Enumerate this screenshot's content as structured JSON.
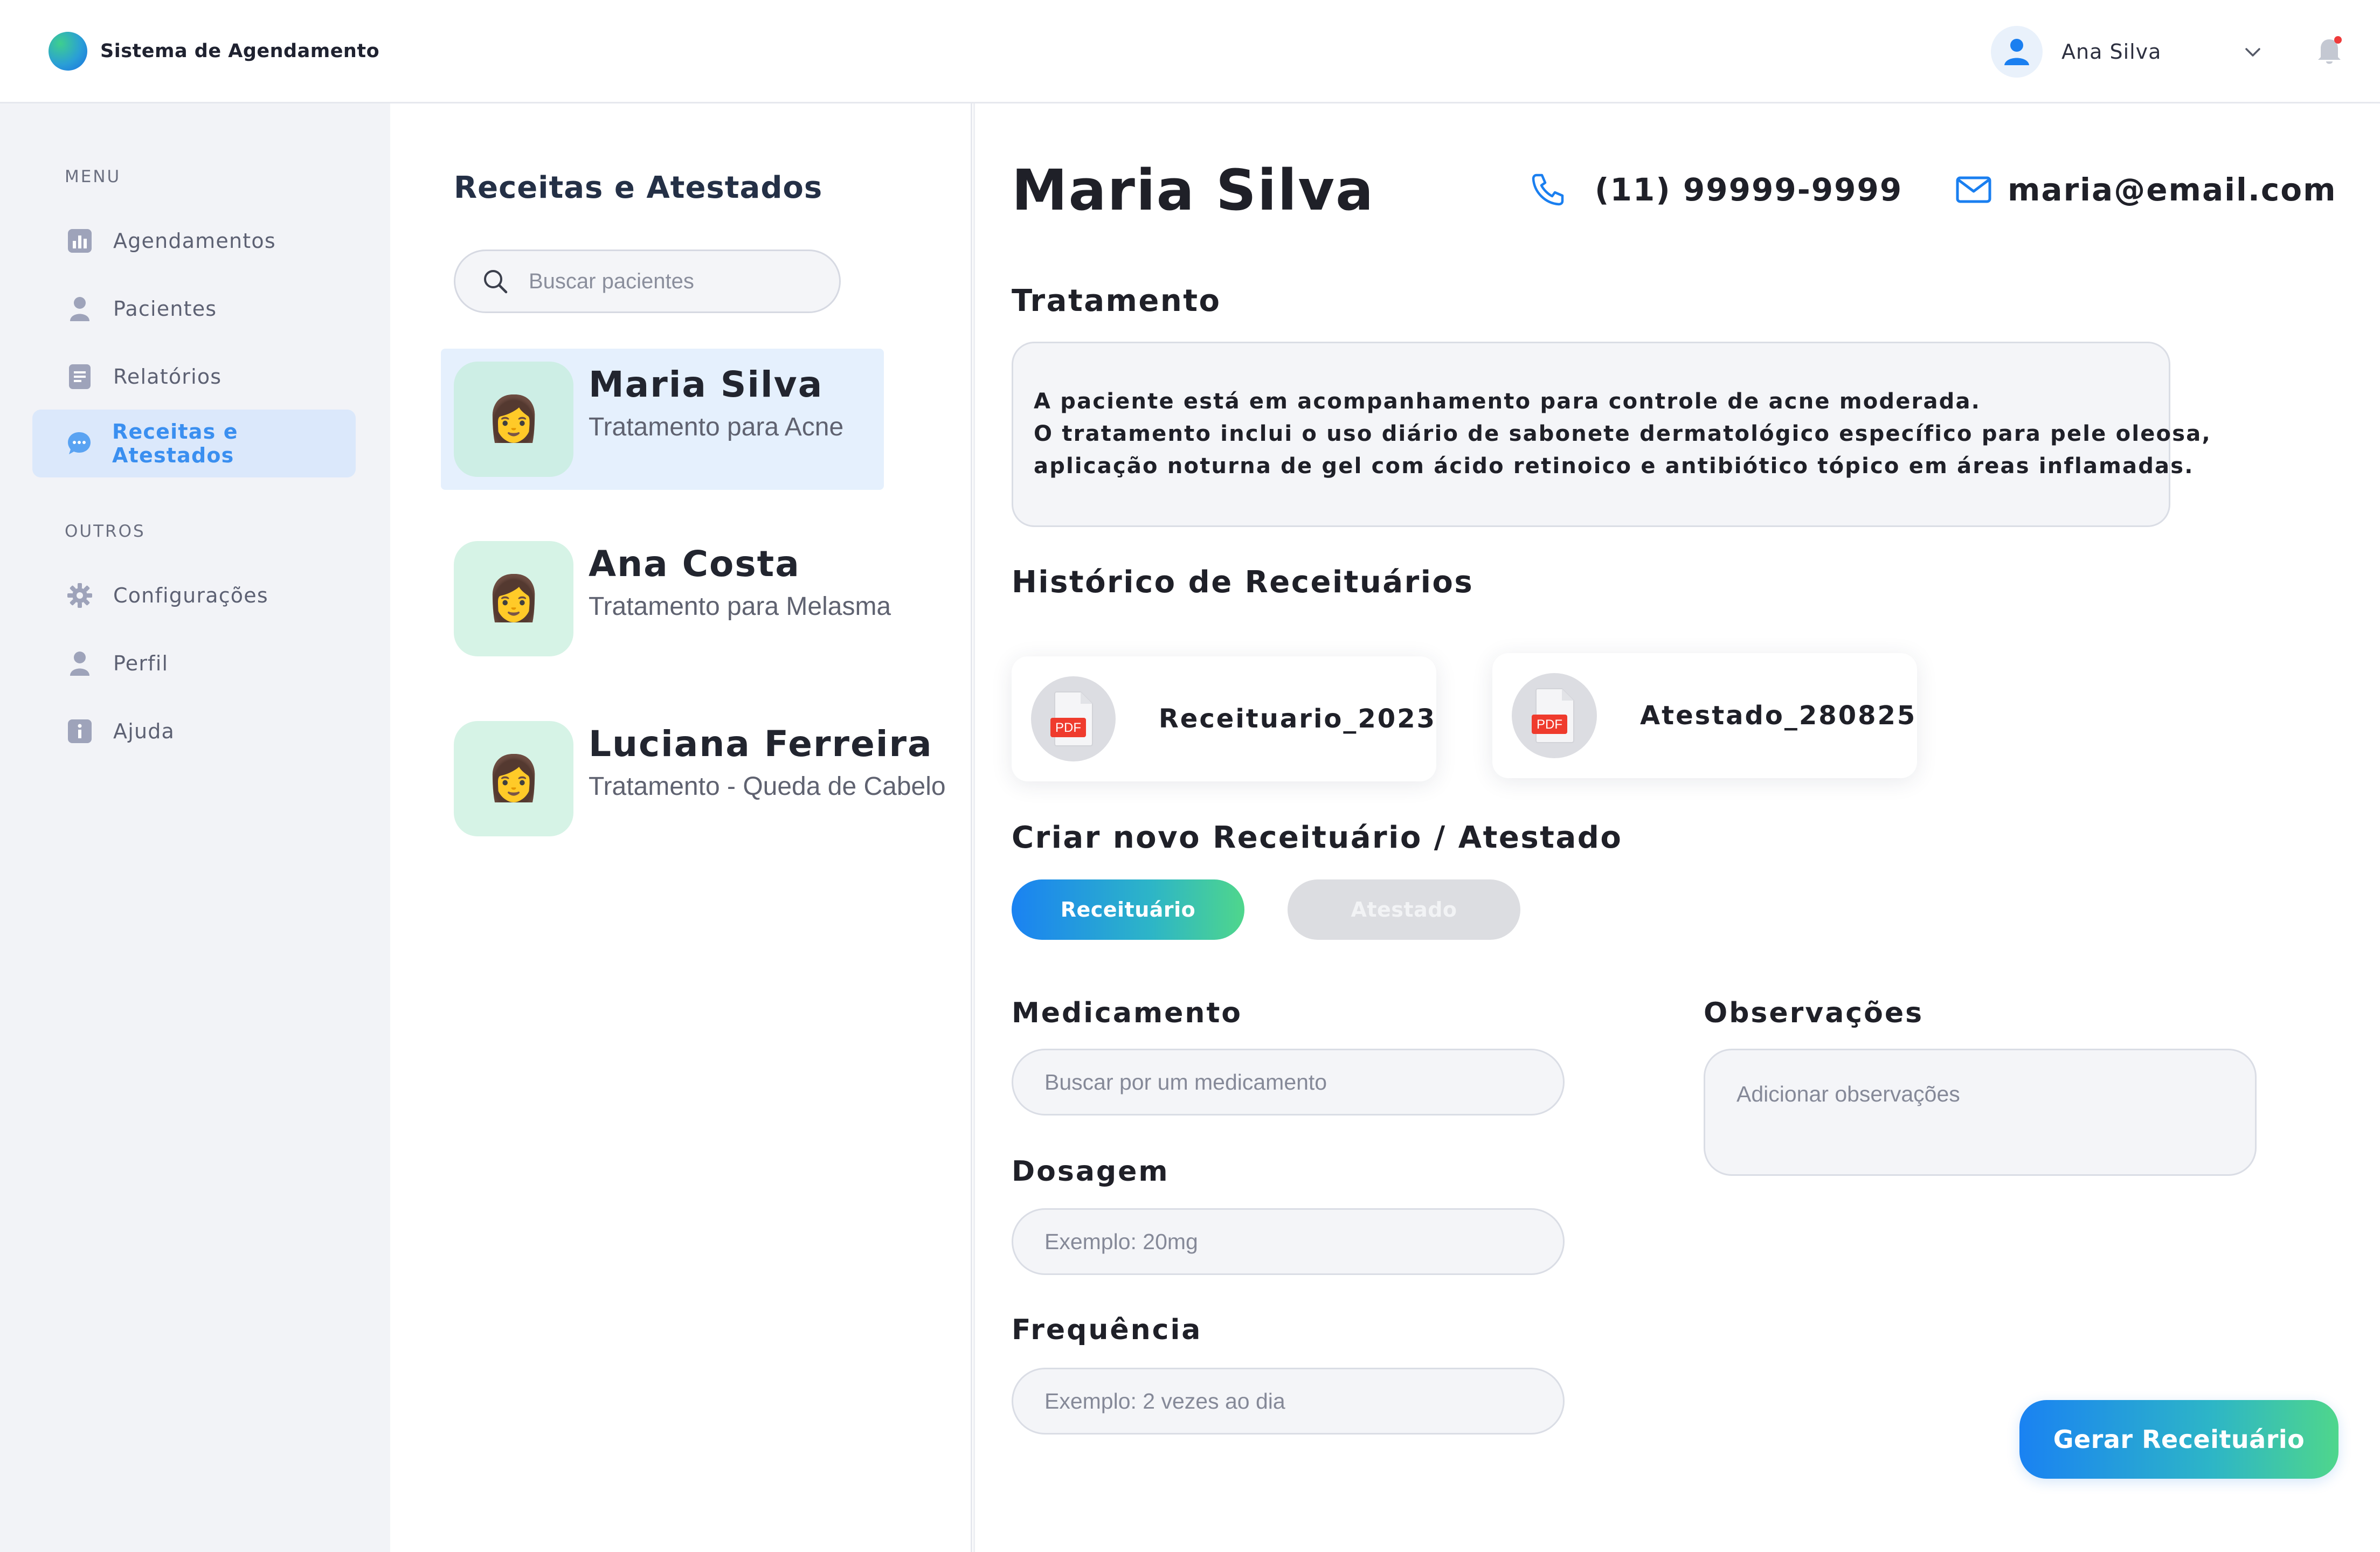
{
  "brand": {
    "name": "Sistema de Agendamento"
  },
  "user": {
    "name": "Ana Silva"
  },
  "sidebar": {
    "menu_label": "MENU",
    "others_label": "OUTROS",
    "menu_items": [
      {
        "label": "Agendamentos",
        "icon": "chart-icon"
      },
      {
        "label": "Pacientes",
        "icon": "user-icon"
      },
      {
        "label": "Relatórios",
        "icon": "document-icon"
      },
      {
        "label": "Receitas e Atestados",
        "icon": "chat-icon",
        "active": true
      }
    ],
    "other_items": [
      {
        "label": "Configurações",
        "icon": "gear-icon"
      },
      {
        "label": "Perfil",
        "icon": "user-icon"
      },
      {
        "label": "Ajuda",
        "icon": "info-icon"
      }
    ]
  },
  "middle": {
    "title": "Receitas e Atestados",
    "search_placeholder": "Buscar pacientes",
    "patients": [
      {
        "name": "Maria Silva",
        "desc": "Tratamento para Acne",
        "avatar": "👩",
        "selected": true
      },
      {
        "name": "Ana Costa",
        "desc": "Tratamento para Melasma",
        "avatar": "👩"
      },
      {
        "name": "Luciana Ferreira",
        "desc": "Tratamento - Queda de Cabelo",
        "avatar": "👩"
      }
    ]
  },
  "main": {
    "patient_name": "Maria Silva",
    "phone": "(11) 99999-9999",
    "email": "maria@email.com",
    "treatment_title": "Tratamento",
    "treatment_lines": [
      "A paciente está em acompanhamento para controle de acne moderada.",
      "O tratamento inclui o uso diário de sabonete dermatológico específico para pele oleosa,",
      "aplicação noturna de gel com ácido retinoico e antibiótico tópico em áreas inflamadas."
    ],
    "history_title": "Histórico de Receituários",
    "documents": [
      {
        "name": "Receituario_2023",
        "badge": "PDF"
      },
      {
        "name": "Atestado_280825",
        "badge": "PDF"
      }
    ],
    "create_title": "Criar novo Receituário / Atestado",
    "tabs": [
      {
        "label": "Receituário",
        "active": true
      },
      {
        "label": "Atestado",
        "active": false
      }
    ],
    "form": {
      "medication_label": "Medicamento",
      "medication_placeholder": "Buscar por um medicamento",
      "dosage_label": "Dosagem",
      "dosage_placeholder": "Exemplo: 20mg",
      "frequency_label": "Frequência",
      "frequency_placeholder": "Exemplo: 2 vezes ao dia",
      "observations_label": "Observações",
      "observations_placeholder": "Adicionar observações"
    },
    "generate_label": "Gerar Receituário"
  },
  "colors": {
    "accent": "#1a82f2",
    "accent_green": "#4fd68c",
    "sidebar_bg": "#f2f3f7",
    "active_item_bg": "#dbe8fb",
    "avatar_bg": "#d6f3e6"
  }
}
